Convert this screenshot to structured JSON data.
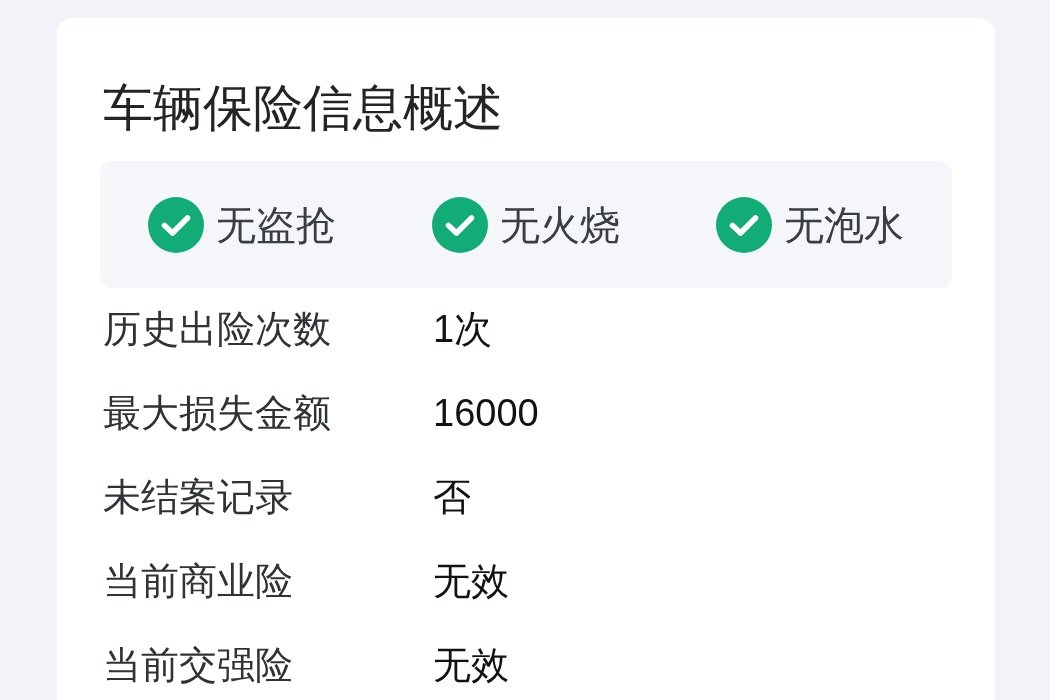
{
  "card": {
    "title": "车辆保险信息概述",
    "badges": [
      {
        "label": "无盗抢",
        "checked": true
      },
      {
        "label": "无火烧",
        "checked": true
      },
      {
        "label": "无泡水",
        "checked": true
      }
    ],
    "rows": [
      {
        "label": "历史出险次数",
        "value": "1次"
      },
      {
        "label": "最大损失金额",
        "value": "16000"
      },
      {
        "label": "未结案记录",
        "value": "否"
      },
      {
        "label": "当前商业险",
        "value": "无效"
      },
      {
        "label": "当前交强险",
        "value": "无效"
      }
    ]
  }
}
